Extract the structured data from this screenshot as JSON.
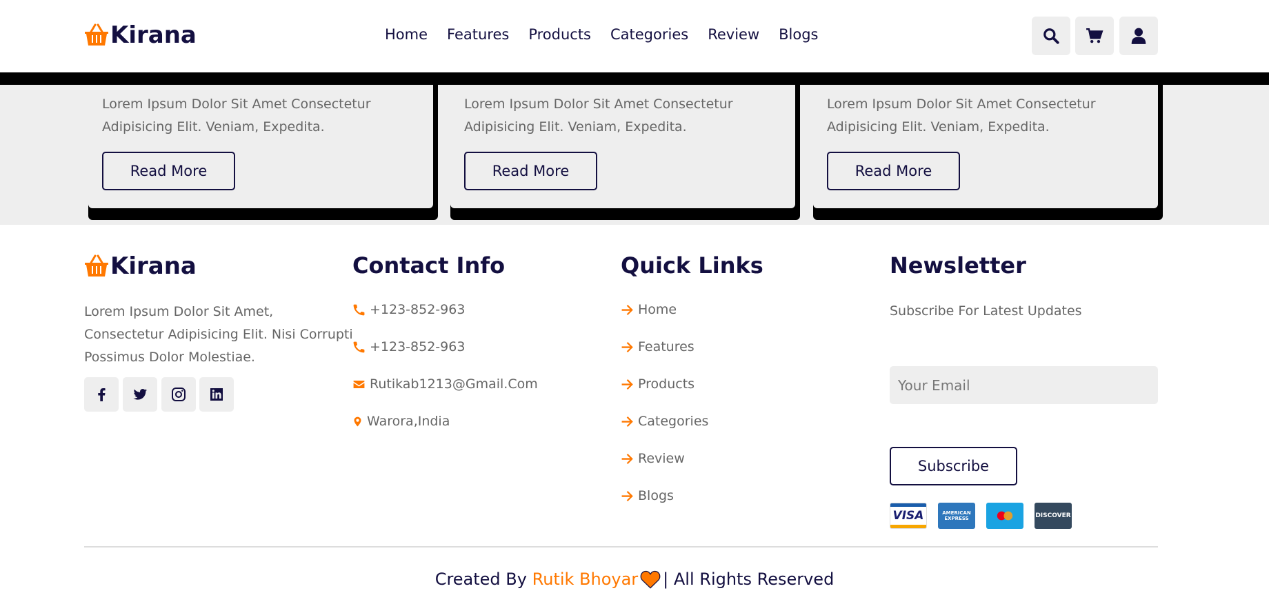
{
  "brand": {
    "name": "Kirana",
    "accent": "#ff7800",
    "primary": "#130f40"
  },
  "nav": {
    "items": [
      "Home",
      "Features",
      "Products",
      "Categories",
      "Review",
      "Blogs"
    ]
  },
  "header_icons": [
    "search-icon",
    "cart-icon",
    "user-icon"
  ],
  "blogs": [
    {
      "text": "Lorem Ipsum Dolor Sit Amet Consectetur Adipisicing Elit. Veniam, Expedita.",
      "button": "Read More"
    },
    {
      "text": "Lorem Ipsum Dolor Sit Amet Consectetur Adipisicing Elit. Veniam, Expedita.",
      "button": "Read More"
    },
    {
      "text": "Lorem Ipsum Dolor Sit Amet Consectetur Adipisicing Elit. Veniam, Expedita.",
      "button": "Read More"
    }
  ],
  "footer": {
    "about": {
      "title": "Kirana",
      "text": "Lorem Ipsum Dolor Sit Amet, Consectetur Adipisicing Elit. Nisi Corrupti Possimus Dolor Molestiae.",
      "social": [
        "facebook-icon",
        "twitter-icon",
        "instagram-icon",
        "linkedin-icon"
      ]
    },
    "contact": {
      "title": "Contact Info",
      "items": [
        {
          "icon": "phone-icon",
          "text": "+123-852-963"
        },
        {
          "icon": "phone-icon",
          "text": "+123-852-963"
        },
        {
          "icon": "envelope-icon",
          "text": "Rutikab1213@Gmail.Com"
        },
        {
          "icon": "map-marker-icon",
          "text": "Warora,India"
        }
      ]
    },
    "quick_links": {
      "title": "Quick Links",
      "items": [
        "Home",
        "Features",
        "Products",
        "Categories",
        "Review",
        "Blogs"
      ]
    },
    "newsletter": {
      "title": "Newsletter",
      "text": "Subscribe For Latest Updates",
      "placeholder": "Your Email",
      "button": "Subscribe",
      "payments": [
        "VISA",
        "AMERICAN EXPRESS",
        "mastercard",
        "DISCOVER"
      ]
    }
  },
  "credit": {
    "prefix": "Created By",
    "author": "Rutik Bhoyar",
    "suffix": "| All Rights Reserved"
  }
}
